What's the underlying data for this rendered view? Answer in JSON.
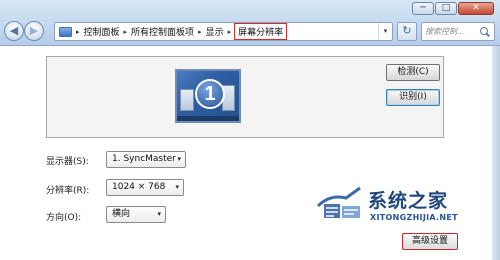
{
  "window": {
    "min_label": "─",
    "max_label": "□",
    "close_label": "✕"
  },
  "nav": {
    "back_glyph": "◀",
    "forward_glyph": "▶"
  },
  "breadcrumb": {
    "items": [
      "控制面板",
      "所有控制面板项",
      "显示",
      "屏幕分辨率"
    ],
    "separator": "▸",
    "dropdown_glyph": "▾"
  },
  "toolbar": {
    "refresh_glyph": "↻",
    "search_placeholder": "搜索控制..."
  },
  "preview": {
    "monitor_number": "1",
    "detect_label": "检测(C)",
    "identify_label": "识别(I)"
  },
  "settings": {
    "display_label": "显示器(S):",
    "display_value": "1. SyncMaster",
    "resolution_label": "分辨率(R):",
    "resolution_value": "1024 × 768",
    "orientation_label": "方向(O):",
    "orientation_value": "横向",
    "select_arrow": "▾"
  },
  "advanced": {
    "label": "高级设置"
  },
  "watermark": {
    "brand": "系统之家",
    "url": "XITONGZHIJIA.NET"
  },
  "colors": {
    "highlight_border": "#e02a2a",
    "chrome_blue": "#c4d9ef",
    "logo_blue": "#20467d"
  }
}
